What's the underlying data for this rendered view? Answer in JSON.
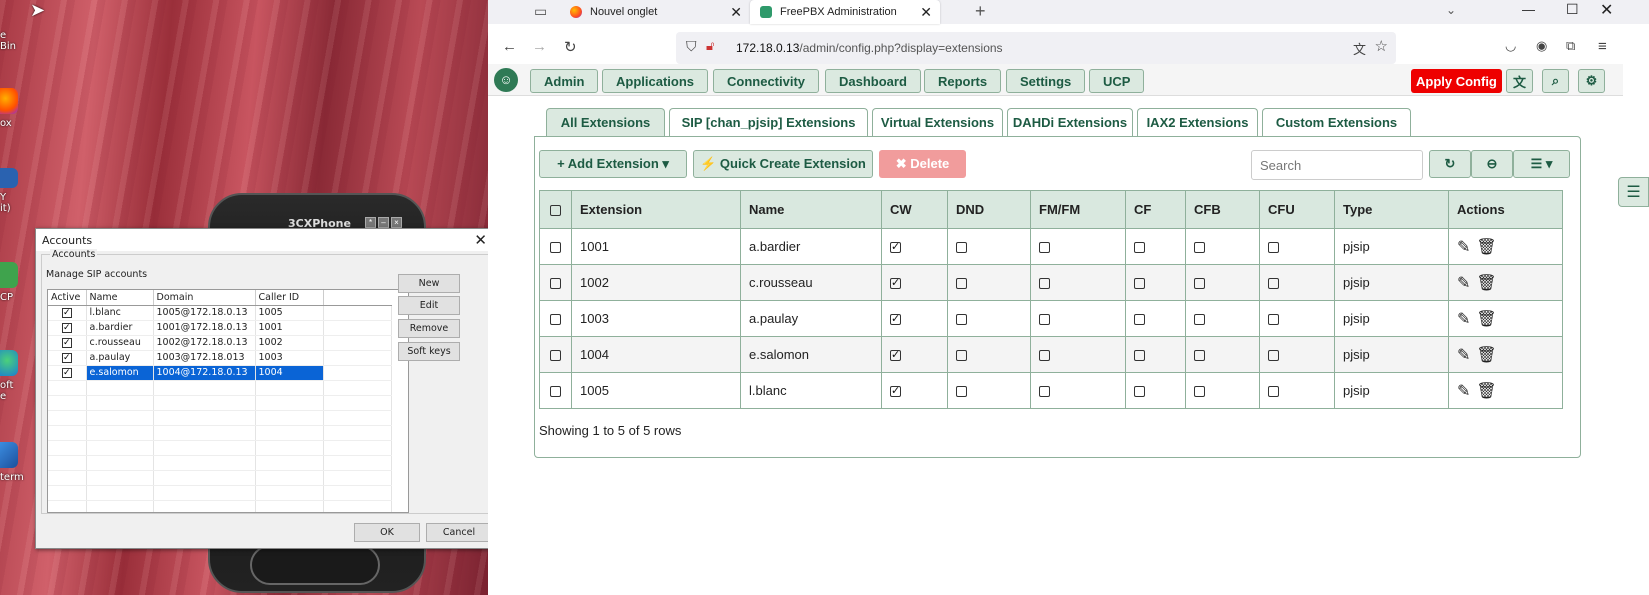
{
  "desktop": {
    "icons": [
      {
        "label": "e Bin"
      },
      {
        "label": "ox"
      },
      {
        "label": "Y\nit)"
      },
      {
        "label": "CP"
      },
      {
        "label": "oft\ne"
      },
      {
        "label": "term"
      }
    ]
  },
  "phone": {
    "brand": "3CXPhone"
  },
  "accounts_dialog": {
    "title": "Accounts",
    "group_label": "Accounts",
    "message": "Manage SIP accounts",
    "columns": [
      "Active",
      "Name",
      "Domain",
      "Caller ID"
    ],
    "rows": [
      {
        "active": true,
        "name": "l.blanc",
        "domain": "1005@172.18.0.13",
        "caller_id": "1005",
        "selected": false
      },
      {
        "active": true,
        "name": "a.bardier",
        "domain": "1001@172.18.0.13",
        "caller_id": "1001",
        "selected": false
      },
      {
        "active": true,
        "name": "c.rousseau",
        "domain": "1002@172.18.0.13",
        "caller_id": "1002",
        "selected": false
      },
      {
        "active": true,
        "name": "a.paulay",
        "domain": "1003@172.18.013",
        "caller_id": "1003",
        "selected": false
      },
      {
        "active": true,
        "name": "e.salomon",
        "domain": "1004@172.18.0.13",
        "caller_id": "1004",
        "selected": true
      }
    ],
    "buttons": {
      "new": "New",
      "edit": "Edit",
      "remove": "Remove",
      "soft_keys": "Soft keys",
      "ok": "OK",
      "cancel": "Cancel"
    }
  },
  "browser": {
    "tabs": [
      {
        "label": "Nouvel onglet",
        "active": false
      },
      {
        "label": "FreePBX Administration",
        "active": true
      }
    ],
    "new_tab": "+",
    "url_host": "172.18.0.13",
    "url_path": "/admin/config.php?display=extensions"
  },
  "freepbx": {
    "menu": [
      "Admin",
      "Applications",
      "Connectivity",
      "Dashboard",
      "Reports",
      "Settings",
      "UCP"
    ],
    "apply_config": "Apply Config",
    "ext_tabs": [
      {
        "label": "All Extensions",
        "active": true
      },
      {
        "label": "SIP [chan_pjsip] Extensions",
        "active": false
      },
      {
        "label": "Virtual Extensions",
        "active": false
      },
      {
        "label": "DAHDi Extensions",
        "active": false
      },
      {
        "label": "IAX2 Extensions",
        "active": false
      },
      {
        "label": "Custom Extensions",
        "active": false
      }
    ],
    "toolbar": {
      "add_extension": "+ Add Extension ▾",
      "quick_create": "⚡ Quick Create Extension",
      "delete": "✖ Delete",
      "search_placeholder": "Search"
    },
    "table": {
      "columns": [
        "Extension",
        "Name",
        "CW",
        "DND",
        "FM/FM",
        "CF",
        "CFB",
        "CFU",
        "Type",
        "Actions"
      ],
      "rows": [
        {
          "extension": "1001",
          "name": "a.bardier",
          "cw": true,
          "dnd": false,
          "fmfm": false,
          "cf": false,
          "cfb": false,
          "cfu": false,
          "type": "pjsip"
        },
        {
          "extension": "1002",
          "name": "c.rousseau",
          "cw": true,
          "dnd": false,
          "fmfm": false,
          "cf": false,
          "cfb": false,
          "cfu": false,
          "type": "pjsip"
        },
        {
          "extension": "1003",
          "name": "a.paulay",
          "cw": true,
          "dnd": false,
          "fmfm": false,
          "cf": false,
          "cfb": false,
          "cfu": false,
          "type": "pjsip"
        },
        {
          "extension": "1004",
          "name": "e.salomon",
          "cw": true,
          "dnd": false,
          "fmfm": false,
          "cf": false,
          "cfb": false,
          "cfu": false,
          "type": "pjsip"
        },
        {
          "extension": "1005",
          "name": "l.blanc",
          "cw": true,
          "dnd": false,
          "fmfm": false,
          "cf": false,
          "cfb": false,
          "cfu": false,
          "type": "pjsip"
        }
      ]
    },
    "footer": "Showing 1 to 5 of 5 rows"
  },
  "colors": {
    "accent": "#1d5b43",
    "apply": "#ee0000",
    "selection": "#0a64d6"
  }
}
